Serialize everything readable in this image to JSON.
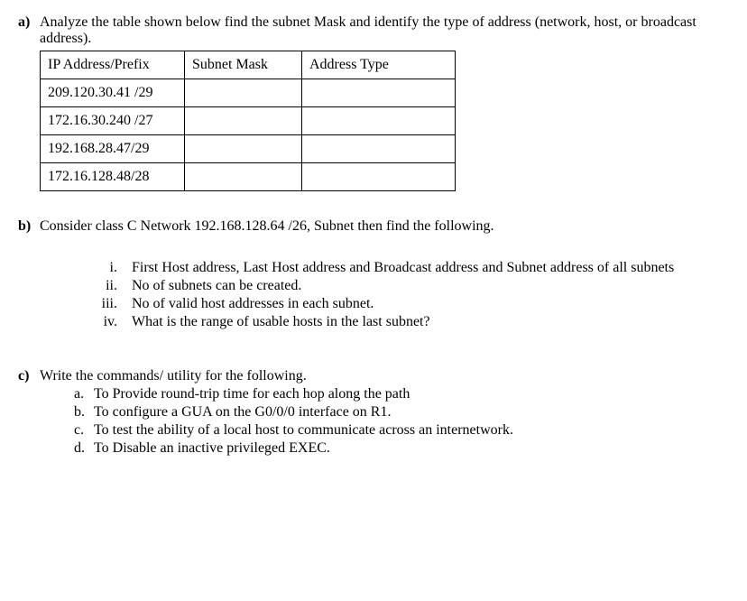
{
  "qa": {
    "label": "a)",
    "text": "Analyze the table shown below find the subnet Mask and identify the type of address (network, host, or broadcast address).",
    "table": {
      "headers": [
        "IP Address/Prefix",
        "Subnet Mask",
        "Address Type"
      ],
      "rows": [
        [
          "209.120.30.41 /29",
          "",
          ""
        ],
        [
          "172.16.30.240 /27",
          "",
          ""
        ],
        [
          "192.168.28.47/29",
          "",
          ""
        ],
        [
          "172.16.128.48/28",
          "",
          ""
        ]
      ]
    }
  },
  "qb": {
    "label": "b)",
    "text": "Consider class C Network 192.168.128.64 /26, Subnet then find the following.",
    "items": [
      {
        "marker": "i.",
        "text": "First Host address, Last Host address and Broadcast address and Subnet address of all subnets"
      },
      {
        "marker": "ii.",
        "text": "No of subnets can be created."
      },
      {
        "marker": "iii.",
        "text": "No of valid host addresses in each subnet."
      },
      {
        "marker": "iv.",
        "text": "What is the range of usable hosts in the last subnet?"
      }
    ]
  },
  "qc": {
    "label": "c)",
    "text": "Write the commands/ utility for the following.",
    "items": [
      {
        "marker": "a.",
        "text": "To Provide round-trip time for each hop along the path"
      },
      {
        "marker": "b.",
        "text": "To configure a GUA on the G0/0/0 interface on R1."
      },
      {
        "marker": "c.",
        "text": "To test the ability of a local host to communicate across an internetwork."
      },
      {
        "marker": "d.",
        "text": "To Disable an inactive privileged EXEC."
      }
    ]
  }
}
